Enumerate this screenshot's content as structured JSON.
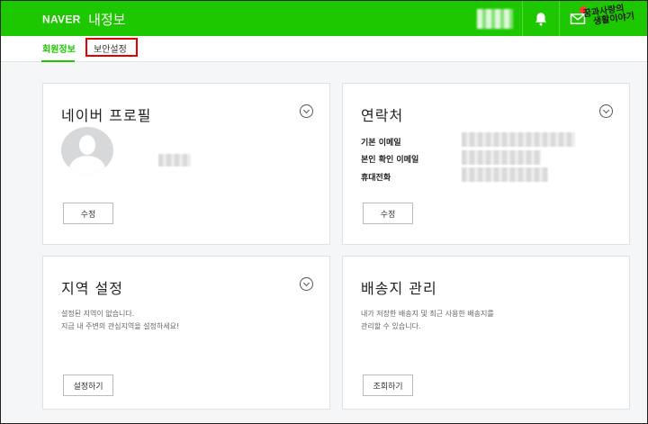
{
  "header": {
    "brand": "NAVER",
    "title": "내정보",
    "sticker_line1": "꿈과사랑의",
    "sticker_line2": "생활이야기"
  },
  "tabs": [
    {
      "label": "회원정보",
      "active": true
    },
    {
      "label": "보안설정",
      "active": false
    }
  ],
  "cards": {
    "profile": {
      "title": "네이버 프로필",
      "button": "수정"
    },
    "contact": {
      "title": "연락처",
      "labels": [
        "기본 이메일",
        "본인 확인 이메일",
        "휴대전화"
      ],
      "button": "수정"
    },
    "region": {
      "title": "지역 설정",
      "desc1": "설정된 지역이 없습니다.",
      "desc2": "지금 내 주변의 관심지역을 설정하세요!",
      "button": "설정하기"
    },
    "shipping": {
      "title": "배송지 관리",
      "desc1": "내가 저장한 배송지 및 최근 사용한 배송지를",
      "desc2": "관리할 수 있습니다.",
      "button": "조회하기"
    }
  },
  "colors": {
    "brand_green": "#1ec800",
    "highlight_red": "#e00000"
  }
}
